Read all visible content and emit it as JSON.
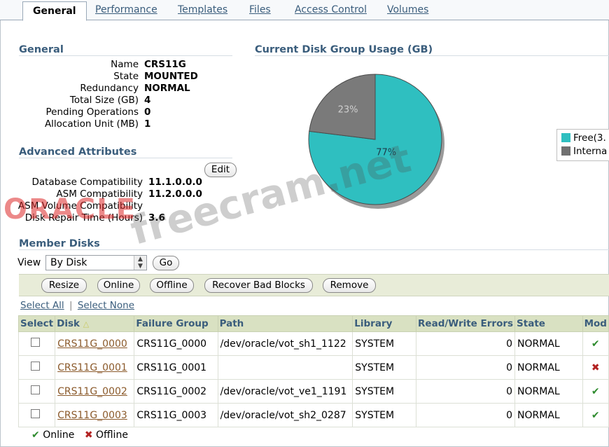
{
  "tabs": [
    "General",
    "Performance",
    "Templates",
    "Files",
    "Access Control",
    "Volumes"
  ],
  "general": {
    "title": "General",
    "rows": [
      {
        "label": "Name",
        "value": "CRS11G"
      },
      {
        "label": "State",
        "value": "MOUNTED"
      },
      {
        "label": "Redundancy",
        "value": "NORMAL"
      },
      {
        "label": "Total Size (GB)",
        "value": "4"
      },
      {
        "label": "Pending Operations",
        "value": "0"
      },
      {
        "label": "Allocation Unit (MB)",
        "value": "1"
      }
    ]
  },
  "advanced": {
    "title": "Advanced Attributes",
    "edit_label": "Edit",
    "rows": [
      {
        "label": "Database Compatibility",
        "value": "11.1.0.0.0"
      },
      {
        "label": "ASM Compatibility",
        "value": "11.2.0.0.0"
      },
      {
        "label": "ASM Volume Compatibility",
        "value": ""
      },
      {
        "label": "Disk Repair Time (Hours)",
        "value": "3.6"
      }
    ]
  },
  "usage": {
    "title": "Current Disk Group Usage (GB)",
    "legend": [
      "Free(3.",
      "Interna"
    ],
    "slice_labels": [
      "77%",
      "23%"
    ]
  },
  "chart_data": {
    "type": "pie",
    "title": "Current Disk Group Usage (GB)",
    "categories": [
      "Free",
      "Internal"
    ],
    "values": [
      77,
      23
    ],
    "colors": [
      "#2fbfc0",
      "#7a7a7a"
    ]
  },
  "member": {
    "title": "Member Disks",
    "view_label": "View",
    "view_value": "By Disk",
    "go_label": "Go",
    "actions": [
      "Resize",
      "Online",
      "Offline",
      "Recover Bad Blocks",
      "Remove"
    ],
    "select_all": "Select All",
    "select_none": "Select None",
    "columns": [
      "Select",
      "Disk",
      "Failure Group",
      "Path",
      "Library",
      "Read/Write Errors",
      "State",
      "Mod"
    ],
    "rows": [
      {
        "disk": "CRS11G_0000",
        "fg": "CRS11G_0000",
        "path": "/dev/oracle/vot_sh1_1122",
        "lib": "SYSTEM",
        "errors": "0",
        "state": "NORMAL",
        "mode": "online"
      },
      {
        "disk": "CRS11G_0001",
        "fg": "CRS11G_0001",
        "path": "",
        "lib": "SYSTEM",
        "errors": "0",
        "state": "NORMAL",
        "mode": "offline"
      },
      {
        "disk": "CRS11G_0002",
        "fg": "CRS11G_0002",
        "path": "/dev/oracle/vot_ve1_1191",
        "lib": "SYSTEM",
        "errors": "0",
        "state": "NORMAL",
        "mode": "online"
      },
      {
        "disk": "CRS11G_0003",
        "fg": "CRS11G_0003",
        "path": "/dev/oracle/vot_sh2_0287",
        "lib": "SYSTEM",
        "errors": "0",
        "state": "NORMAL",
        "mode": "online"
      }
    ],
    "legend_online": "Online",
    "legend_offline": "Offline"
  },
  "watermark": {
    "oracle": "ORACLE",
    "site": "freecram.net"
  }
}
